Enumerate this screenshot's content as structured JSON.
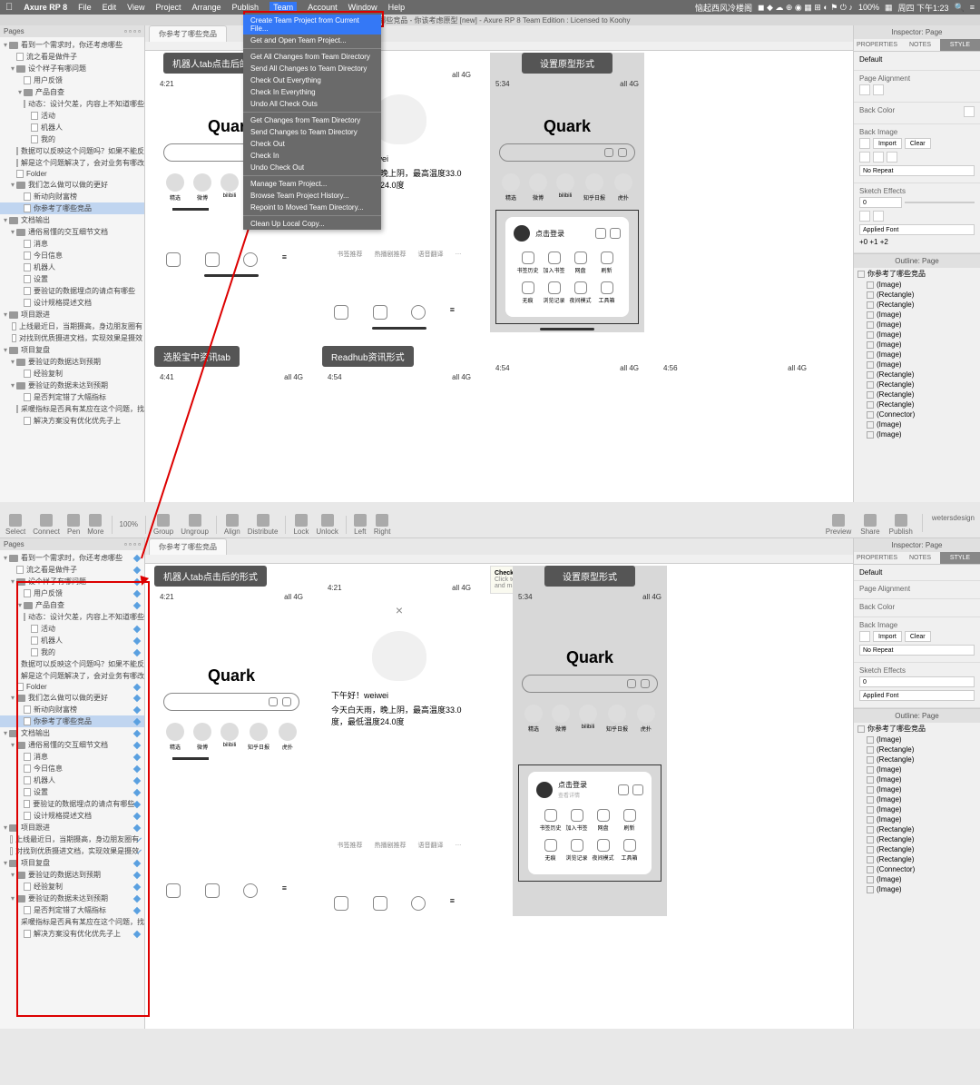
{
  "menubar": {
    "app": "Axure RP 8",
    "items": [
      "File",
      "Edit",
      "View",
      "Project",
      "Arrange",
      "Publish",
      "Team",
      "Account",
      "Window",
      "Help"
    ],
    "title": "你参考了哪些竞品 - 你该考虑原型 [new] - Axure RP 8 Team Edition : Licensed to Koohy",
    "status": "恼起西风冷楼阁",
    "zoom": "100%",
    "clock": "周四 下午1:23"
  },
  "team_menu": {
    "items": [
      "Create Team Project from Current File...",
      "Get and Open Team Project...",
      "",
      "Get All Changes from Team Directory",
      "Send All Changes to Team Directory",
      "Check Out Everything",
      "Check In Everything",
      "Undo All Check Outs",
      "",
      "Get Changes from Team Directory",
      "Send Changes to Team Directory",
      "Check Out",
      "Check In",
      "Undo Check Out",
      "",
      "Manage Team Project...",
      "Browse Team Project History...",
      "Repoint to Moved Team Directory...",
      "",
      "Clean Up Local Copy..."
    ]
  },
  "toolbar": {
    "items": [
      "Select",
      "Connect",
      "Pen",
      "More"
    ],
    "zoom": "100%",
    "right": [
      "Preview",
      "Share",
      "Publish"
    ],
    "user": "wetersdesign"
  },
  "pages": {
    "title": "Pages",
    "tree": [
      {
        "l": 0,
        "t": "f",
        "n": "看到一个需求时，你还考虑哪些"
      },
      {
        "l": 1,
        "t": "p",
        "n": "流之看是做件子"
      },
      {
        "l": 1,
        "t": "f",
        "n": "设个样子有哪问题"
      },
      {
        "l": 2,
        "t": "p",
        "n": "用户反馈"
      },
      {
        "l": 2,
        "t": "f",
        "n": "产品自查"
      },
      {
        "l": 3,
        "t": "p",
        "n": "动态：设计欠差，内容上不知道哪些"
      },
      {
        "l": 3,
        "t": "p",
        "n": "活动"
      },
      {
        "l": 3,
        "t": "p",
        "n": "机器人"
      },
      {
        "l": 3,
        "t": "p",
        "n": "我的"
      },
      {
        "l": 2,
        "t": "p",
        "n": "数据可以反映这个问题吗？如果不能反"
      },
      {
        "l": 2,
        "t": "p",
        "n": "解是这个问题解决了，会对业务有哪改革，"
      },
      {
        "l": 1,
        "t": "p",
        "n": "Folder"
      },
      {
        "l": 1,
        "t": "f",
        "n": "我们怎么做可以做的更好"
      },
      {
        "l": 2,
        "t": "p",
        "n": "新动向财富榜"
      },
      {
        "l": 2,
        "t": "p",
        "n": "你参考了哪些竞品",
        "sel": true
      },
      {
        "l": 0,
        "t": "f",
        "n": "文档输出"
      },
      {
        "l": 1,
        "t": "f",
        "n": "通俗易懂的交互细节文档"
      },
      {
        "l": 2,
        "t": "p",
        "n": "消息"
      },
      {
        "l": 2,
        "t": "p",
        "n": "今日信息"
      },
      {
        "l": 2,
        "t": "p",
        "n": "机器人"
      },
      {
        "l": 2,
        "t": "p",
        "n": "设置"
      },
      {
        "l": 2,
        "t": "p",
        "n": "要验证的数据埋点的请点有哪些"
      },
      {
        "l": 2,
        "t": "p",
        "n": "设计规格提述文档"
      },
      {
        "l": 0,
        "t": "f",
        "n": "项目跟进"
      },
      {
        "l": 1,
        "t": "p",
        "n": "上线最近日，当期摄高，身边朋友圈有"
      },
      {
        "l": 1,
        "t": "p",
        "n": "对找到优质摄进文档，实现效果是摄效"
      },
      {
        "l": 0,
        "t": "f",
        "n": "项目复盘"
      },
      {
        "l": 1,
        "t": "f",
        "n": "要验证的数据达到预期"
      },
      {
        "l": 2,
        "t": "p",
        "n": "经验复制"
      },
      {
        "l": 1,
        "t": "f",
        "n": "要验证的数据未达到预期"
      },
      {
        "l": 2,
        "t": "p",
        "n": "是否判定错了大幅指标"
      },
      {
        "l": 2,
        "t": "p",
        "n": "采暖指标是否具有某应在这个问题，找个"
      },
      {
        "l": 2,
        "t": "p",
        "n": "解决方案没有优化优先子上"
      }
    ]
  },
  "tab": "你参考了哪些竞品",
  "mock": {
    "h1": "机器人tab点击后的形式",
    "h2": "设置原型形式",
    "h3": "选股宝中资讯tab",
    "h4": "Readhub资讯形式",
    "time1": "4:21",
    "time2": "5:34",
    "time3": "4:41",
    "time4": "4:54",
    "time5": "4:54",
    "time6": "4:56",
    "sig": "all 4G",
    "logo": "Quark",
    "greet": "下午好！weiwei",
    "weather": "今天白天雨，晚上阴，最高温度33.0度，最低温度24.0度",
    "avatars": [
      "精选",
      "微博",
      "bilibili",
      "知乎日报",
      "虎扑"
    ],
    "chips": [
      "书签推荐",
      "热播剧推荐",
      "语音翻译"
    ],
    "login": "点击登录",
    "login_sub": "查看详情",
    "grid": [
      "书签历史",
      "加入书签",
      "网盘",
      "刷新",
      "无痕",
      "浏览记录",
      "夜间模式",
      "工具箱"
    ]
  },
  "inspector": {
    "title": "Inspector: Page",
    "tabs": [
      "PROPERTIES",
      "NOTES",
      "STYLE"
    ],
    "default": "Default",
    "pa": "Page Alignment",
    "bc": "Back Color",
    "bi": "Back Image",
    "import": "Import",
    "clear": "Clear",
    "norepeat": "No Repeat",
    "se": "Sketch Effects",
    "af": "Applied Font",
    "btns": "+0  +1  +2",
    "co": "Check Out",
    "co_sub": "Click to check out and make changes"
  },
  "outline": {
    "title": "Outline: Page",
    "root": "你参考了哪些竞品",
    "items": [
      "(Image)",
      "(Rectangle)",
      "(Rectangle)",
      "(Image)",
      "(Image)",
      "(Image)",
      "(Image)",
      "(Image)",
      "(Image)",
      "(Rectangle)",
      "(Rectangle)",
      "(Rectangle)",
      "(Rectangle)",
      "(Connector)",
      "(Image)",
      "(Image)"
    ]
  }
}
